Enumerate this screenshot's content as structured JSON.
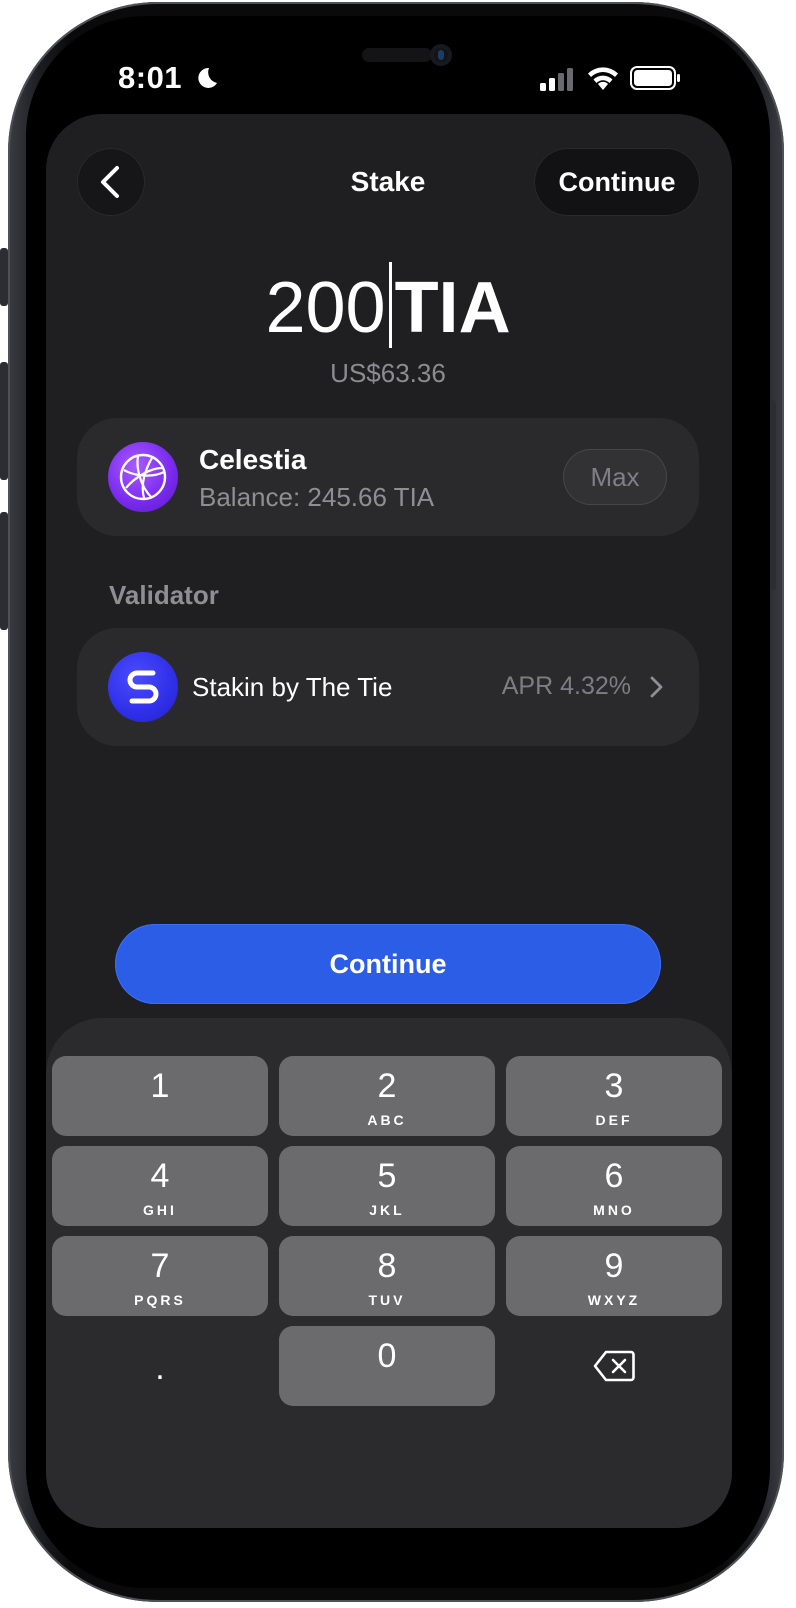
{
  "status_bar": {
    "time": "8:01"
  },
  "header": {
    "title": "Stake",
    "continue_label": "Continue"
  },
  "amount": {
    "value": "200",
    "unit": "TIA",
    "fiat": "US$63.36"
  },
  "asset": {
    "name": "Celestia",
    "balance": "Balance: 245.66 TIA",
    "max_label": "Max"
  },
  "validator": {
    "section_label": "Validator",
    "name": "Stakin by The Tie",
    "apr": "APR 4.32%"
  },
  "primary_button": {
    "label": "Continue"
  },
  "keypad": {
    "keys": [
      {
        "num": "1",
        "letters": ""
      },
      {
        "num": "2",
        "letters": "ABC"
      },
      {
        "num": "3",
        "letters": "DEF"
      },
      {
        "num": "4",
        "letters": "GHI"
      },
      {
        "num": "5",
        "letters": "JKL"
      },
      {
        "num": "6",
        "letters": "MNO"
      },
      {
        "num": "7",
        "letters": "PQRS"
      },
      {
        "num": "8",
        "letters": "TUV"
      },
      {
        "num": "9",
        "letters": "WXYZ"
      },
      {
        "num": ".",
        "letters": ""
      },
      {
        "num": "0",
        "letters": ""
      }
    ]
  },
  "colors": {
    "accent": "#2b5de6",
    "sheet": "#1f1f21",
    "card": "#2a2a2c",
    "key": "#6b6b6d"
  }
}
